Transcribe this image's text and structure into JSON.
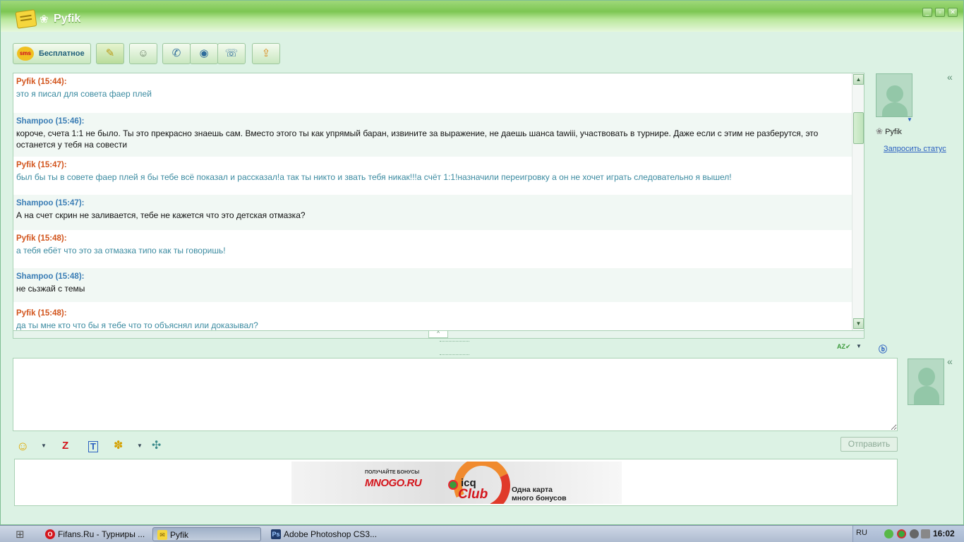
{
  "window": {
    "title": "Pyfik",
    "controls": [
      "minimize-icon",
      "restore-icon",
      "close-icon"
    ]
  },
  "toolbar": {
    "sms_badge": "sms",
    "sms_label": "Бесплатное",
    "icons": [
      "notes-icon",
      "contact-card-icon",
      "phone-icon",
      "webcam-icon",
      "fax-icon",
      "file-transfer-icon"
    ]
  },
  "messages": [
    {
      "author": "Pyfik",
      "header": "Pyfik (15:44):",
      "text": "это я писал для совета фаер плей"
    },
    {
      "author": "Shampoo",
      "header": "Shampoo (15:46):",
      "text": "короче, счета 1:1 не было. Ты это прекрасно знаешь сам. Вместо этого ты как упрямый баран, извините за выражение, не даешь шанса tawiii, участвовать в турнире. Даже если с этим не разберутся, это останется у тебя на совести"
    },
    {
      "author": "Pyfik",
      "header": "Pyfik (15:47):",
      "text": "был бы ты в совете фаер плей я бы тебе всё показал и рассказал!а так ты никто и звать тебя никак!!!а счёт 1:1!назначили переигровку а он не хочет играть следовательно я вышел!"
    },
    {
      "author": "Shampoo",
      "header": "Shampoo (15:47):",
      "text": "А на счет скрин не заливается, тебе не кажется что это детская отмазка?"
    },
    {
      "author": "Pyfik",
      "header": "Pyfik (15:48):",
      "text": "а тебя ебёт что это за отмазка типо как ты говоришь!"
    },
    {
      "author": "Shampoo",
      "header": "Shampoo (15:48):",
      "text": "не сьзжай с темы"
    },
    {
      "author": "Pyfik",
      "header": "Pyfik (15:48):",
      "text": "да ты мне кто что бы я тебе что то объяснял или доказывал?"
    }
  ],
  "contact": {
    "name": "Pyfik",
    "request_status": "Запросить статус"
  },
  "input": {
    "spellcheck_label": "AZ",
    "send_label": "Отправить"
  },
  "ad": {
    "mnogo_top": "ПОЛУЧАЙТЕ БОНУСЫ",
    "mnogo": "MNOGO.RU",
    "icq": "icq",
    "club": "Club",
    "line1": "Одна карта",
    "line2": "много бонусов"
  },
  "taskbar": {
    "items": [
      {
        "label": "Fifans.Ru - Турниры ...",
        "icon": "opera-icon"
      },
      {
        "label": "Pyfik",
        "icon": "icq-chat-icon"
      },
      {
        "label": "Adobe Photoshop CS3...",
        "icon": "photoshop-icon"
      }
    ],
    "language": "RU",
    "clock": "16:02"
  },
  "colors": {
    "pyfik": "#d2541c",
    "shampoo": "#3a7db5",
    "accent_green": "#7cc652"
  }
}
